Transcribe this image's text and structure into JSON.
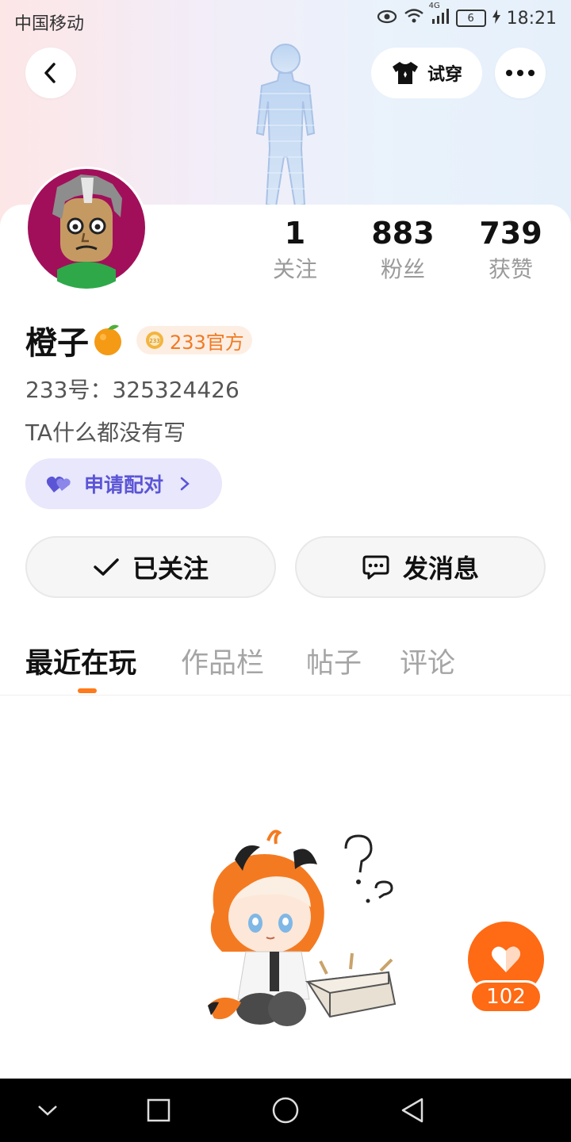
{
  "status_bar": {
    "carrier": "中国移动",
    "network": "4G",
    "battery": "6",
    "time": "18:21"
  },
  "header": {
    "back_icon": "chevron-left-icon",
    "tryon_icon": "tshirt-icon",
    "tryon_label": "试穿",
    "more_icon": "more-dots-icon"
  },
  "profile": {
    "stats": [
      {
        "value": "1",
        "label": "关注"
      },
      {
        "value": "883",
        "label": "粉丝"
      },
      {
        "value": "739",
        "label": "获赞"
      }
    ],
    "name": "橙子",
    "name_emoji": "🍊",
    "badge": "233官方",
    "uid": "233号：325324426",
    "bio": "TA什么都没有写",
    "pair_button": "申请配对",
    "follow_button": "已关注",
    "message_button": "发消息"
  },
  "tabs": [
    {
      "label": "最近在玩",
      "active": true
    },
    {
      "label": "作品栏",
      "active": false
    },
    {
      "label": "帖子",
      "active": false
    },
    {
      "label": "评论",
      "active": false
    }
  ],
  "like_fab": {
    "icon": "heart-icon",
    "count": "102"
  },
  "colors": {
    "accent_orange": "#ff6a14",
    "pair_purple": "#5b55d6",
    "badge_orange": "#f07a22"
  },
  "nav": {
    "back": "nav-back-icon",
    "home": "nav-home-icon",
    "recent": "nav-recent-icon",
    "collapse": "nav-collapse-icon"
  }
}
